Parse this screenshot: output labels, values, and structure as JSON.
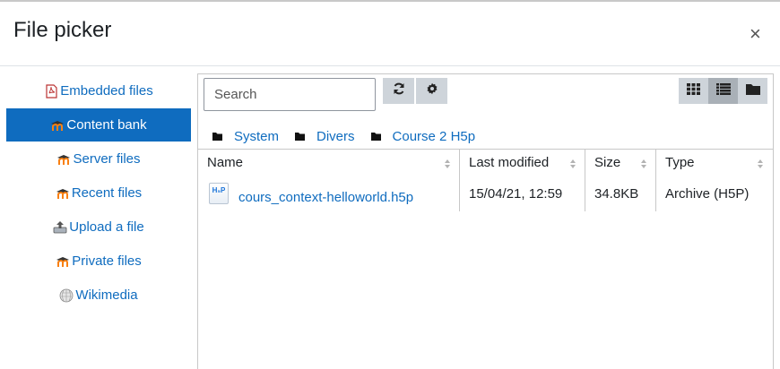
{
  "dialog": {
    "title": "File picker",
    "close_symbol": "×"
  },
  "sidebar": {
    "items": [
      {
        "label": "Embedded files",
        "icon": "pdf-document-icon",
        "active": false
      },
      {
        "label": "Content bank",
        "icon": "moodle-icon",
        "active": true
      },
      {
        "label": "Server files",
        "icon": "moodle-icon",
        "active": false
      },
      {
        "label": "Recent files",
        "icon": "moodle-icon",
        "active": false
      },
      {
        "label": "Upload a file",
        "icon": "upload-icon",
        "active": false
      },
      {
        "label": "Private files",
        "icon": "moodle-icon",
        "active": false
      },
      {
        "label": "Wikimedia",
        "icon": "wikimedia-globe-icon",
        "active": false
      }
    ]
  },
  "toolbar": {
    "search_placeholder": "Search",
    "refresh_icon": "refresh-icon",
    "settings_icon": "gear-icon",
    "views": [
      {
        "icon": "grid-view-icon",
        "active": false
      },
      {
        "icon": "list-view-icon",
        "active": true
      },
      {
        "icon": "tree-view-folder-icon",
        "active": false
      }
    ]
  },
  "breadcrumb": [
    "System",
    "Divers",
    "Course 2 H5p"
  ],
  "table": {
    "columns": [
      "Name",
      "Last modified",
      "Size",
      "Type"
    ],
    "rows": [
      {
        "icon": "h5p-file-icon",
        "icon_text": "H₅P",
        "name": "cours_context-helloworld.h5p",
        "modified": "15/04/21, 12:59",
        "size": "34.8KB",
        "type": "Archive (H5P)"
      }
    ]
  },
  "colors": {
    "accent": "#0f6cbf",
    "button": "#ced4da",
    "border": "#c8c8c8"
  }
}
